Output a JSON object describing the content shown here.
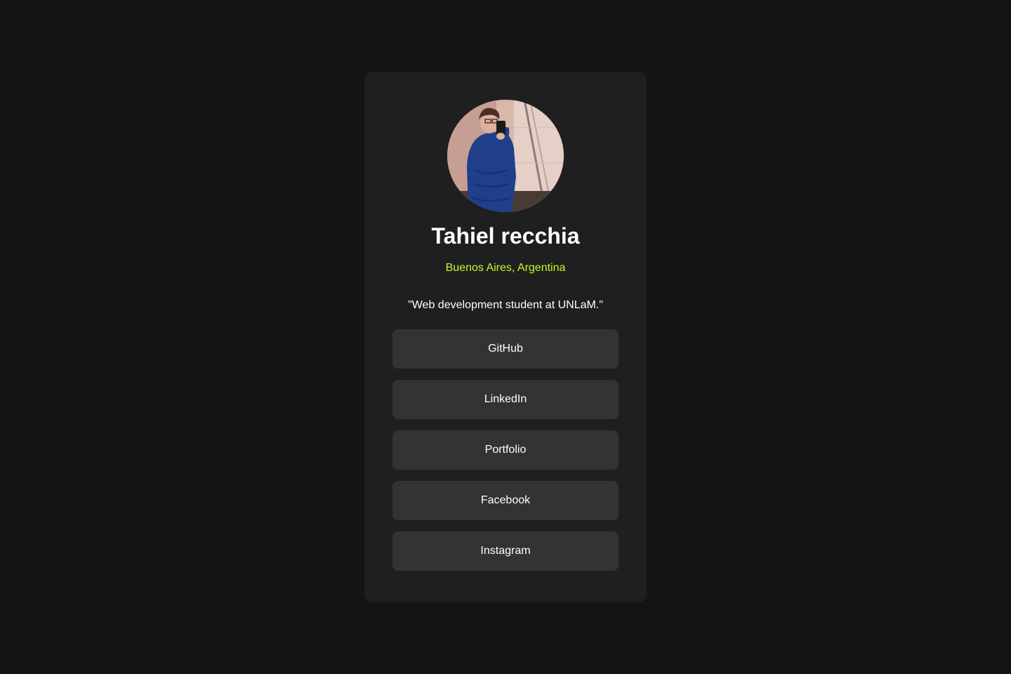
{
  "profile": {
    "name": "Tahiel recchia",
    "location": "Buenos Aires, Argentina",
    "bio": "\"Web development student at UNLaM.\""
  },
  "links": [
    {
      "label": "GitHub"
    },
    {
      "label": "LinkedIn"
    },
    {
      "label": "Portfolio"
    },
    {
      "label": "Facebook"
    },
    {
      "label": "Instagram"
    }
  ],
  "colors": {
    "background": "#141414",
    "card": "#1f1f1f",
    "button": "#333333",
    "accent": "#c4f82a",
    "text": "#ffffff"
  }
}
